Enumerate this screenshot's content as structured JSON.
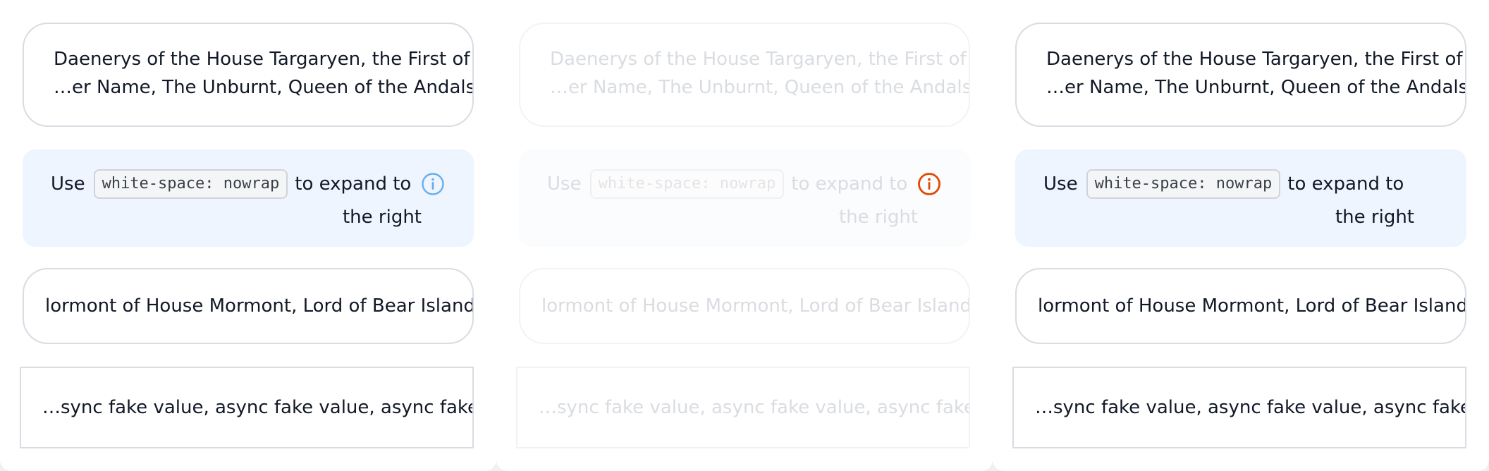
{
  "colors": {
    "info_icon_blue": "#6aaee8",
    "info_icon_orange": "#e04a00",
    "info_bg": "#eef5fe",
    "border": "#d8dce3"
  },
  "panels": [
    {
      "state": "normal",
      "pill_line1": "Daenerys of the House Targaryen, the First of",
      "pill_line2": "…er Name, The Unburnt, Queen of the Andals,",
      "info_use": "Use",
      "info_code": "white-space: nowrap",
      "info_expand": "to expand to",
      "info_right": "the right",
      "info_icon": "info-circle-icon",
      "single": "lormont of House Mormont, Lord of Bear Island",
      "square": "…sync fake value, async fake value, async fake"
    },
    {
      "state": "disabled",
      "pill_line1": "Daenerys of the House Targaryen, the First of",
      "pill_line2": "…er Name, The Unburnt, Queen of the Andals,",
      "info_use": "Use",
      "info_code": "white-space: nowrap",
      "info_expand": "to expand to",
      "info_right": "the right",
      "info_icon": "info-circle-icon",
      "single": "lormont of House Mormont, Lord of Bear Island",
      "square": "…sync fake value, async fake value, async fake"
    },
    {
      "state": "normal",
      "pill_line1": "Daenerys of the House Targaryen, the First of",
      "pill_line2": "…er Name, The Unburnt, Queen of the Andals,",
      "info_use": "Use",
      "info_code": "white-space: nowrap",
      "info_expand": "to expand to",
      "info_right": "the right",
      "single": "lormont of House Mormont, Lord of Bear Island",
      "square": "…sync fake value, async fake value, async fake"
    }
  ]
}
